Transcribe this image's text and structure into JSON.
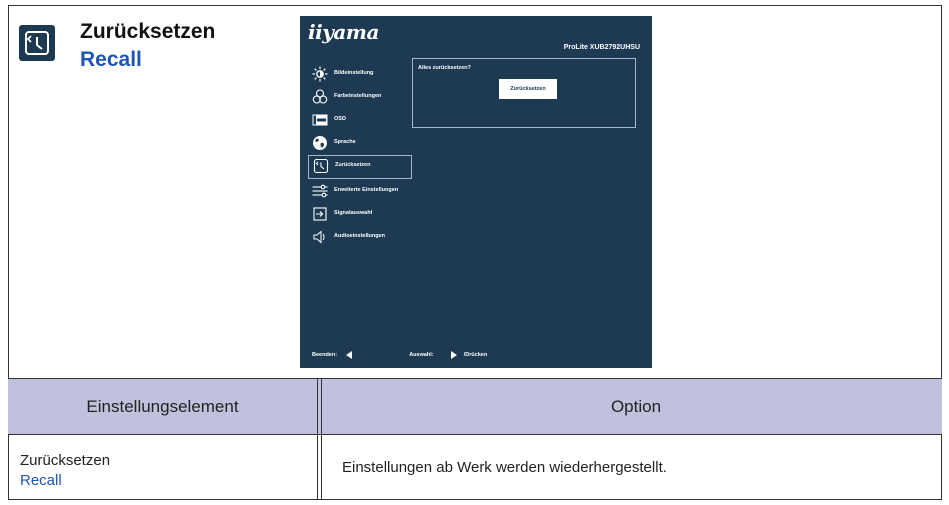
{
  "title": {
    "de": "Zurücksetzen",
    "en": "Recall",
    "icon": "recall-icon"
  },
  "osd": {
    "logo": "iiyama",
    "model": "ProLite XUB2792UHSU",
    "menu": [
      {
        "label": "Bildeinstellung",
        "icon": "brightness-icon"
      },
      {
        "label": "Farbeinstellungen",
        "icon": "color-icon"
      },
      {
        "label": "OSD",
        "icon": "osd-icon"
      },
      {
        "label": "Sprache",
        "icon": "globe-icon"
      },
      {
        "label": "Zurücksetzen",
        "icon": "recall-icon",
        "selected": true
      },
      {
        "label": "Erweiterte Einstellungen",
        "icon": "sliders-icon"
      },
      {
        "label": "Signalauswahl",
        "icon": "input-icon"
      },
      {
        "label": "Audioeinstellungen",
        "icon": "speaker-icon"
      }
    ],
    "panel": {
      "question": "Alles zurücksetzen?",
      "button": "Zurücksetzen"
    },
    "footer": {
      "exit": "Beenden:",
      "select": "Auswahl:",
      "press": "/Drücken"
    },
    "colors": {
      "background": "#1d3a52",
      "border": "#9fb8cc"
    }
  },
  "table": {
    "headers": [
      "Einstellungselement",
      "Option"
    ],
    "rows": [
      {
        "item_de": "Zurücksetzen",
        "item_en": "Recall",
        "option": "Einstellungen ab Werk werden wiederhergestellt."
      }
    ],
    "header_bg": "#c0c2dd",
    "accent": "#1e56b5"
  }
}
